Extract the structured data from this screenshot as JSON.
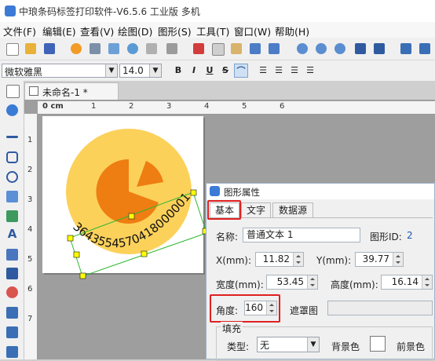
{
  "window": {
    "title": "中琅条码标签打印软件-V6.5.6 工业版 多机"
  },
  "menu": [
    "文件(F)",
    "编辑(E)",
    "查看(V)",
    "绘图(D)",
    "图形(S)",
    "工具(T)",
    "窗口(W)",
    "帮助(H)"
  ],
  "format_bar": {
    "font": "微软雅黑",
    "size": "14.0",
    "bold": "B",
    "italic": "I",
    "underline": "U",
    "strike": "S"
  },
  "document": {
    "tab_label": "未命名-1 *",
    "ruler_unit": "0 cm",
    "hruler_labels": [
      "1",
      "2",
      "3",
      "4",
      "5",
      "6"
    ],
    "vruler_labels": [
      "1",
      "2",
      "3",
      "4",
      "5",
      "6",
      "7"
    ],
    "text_on_arc": "3643554570418000001"
  },
  "dialog": {
    "title": "图形属性",
    "tabs": [
      "基本",
      "文字",
      "数据源"
    ],
    "name_label": "名称:",
    "name_value": "普通文本 1",
    "id_label": "图形ID:",
    "id_value": "2",
    "x_label": "X(mm):",
    "x_value": "11.82",
    "y_label": "Y(mm):",
    "y_value": "39.77",
    "width_label": "宽度(mm):",
    "width_value": "53.45",
    "height_label": "高度(mm):",
    "height_value": "16.14",
    "angle_label": "角度:",
    "angle_value": "160",
    "mask_label": "遮罩图",
    "fill_section": "填充",
    "type_label": "类型:",
    "type_value": "无",
    "bg_label": "背景色",
    "fg_label": "前景色"
  },
  "colors": {
    "accent": "#3b7bd6",
    "highlight": "#e02020",
    "pie_light": "#fcd15a",
    "pie_dark": "#ee7d12"
  }
}
